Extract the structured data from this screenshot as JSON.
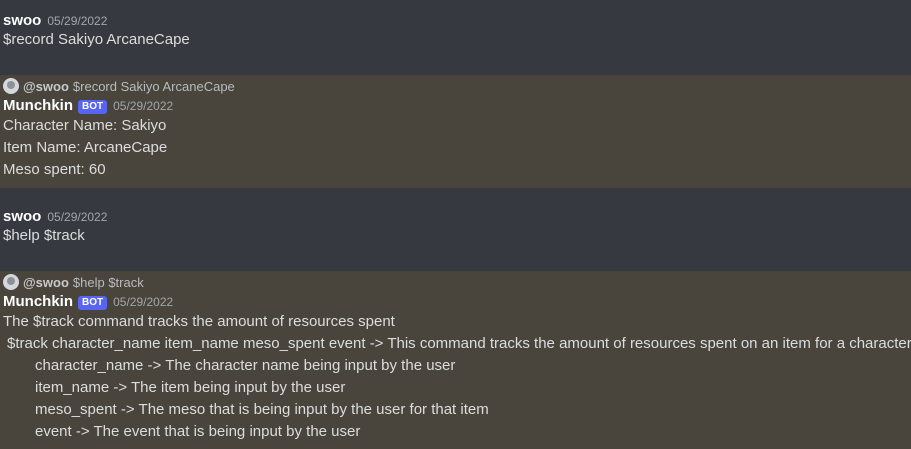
{
  "messages": [
    {
      "author": "swoo",
      "timestamp": "05/29/2022",
      "lines": [
        "$record Sakiyo ArcaneCape"
      ]
    },
    {
      "reply": {
        "user": "@swoo",
        "text": "$record Sakiyo ArcaneCape",
        "avatar_icon": "user-avatar-icon"
      },
      "author": "Munchkin",
      "bot_tag": "BOT",
      "timestamp": "05/29/2022",
      "lines": [
        "Character Name: Sakiyo",
        "Item Name: ArcaneCape",
        "Meso spent: 60"
      ]
    },
    {
      "author": "swoo",
      "timestamp": "05/29/2022",
      "lines": [
        "$help $track"
      ]
    },
    {
      "reply": {
        "user": "@swoo",
        "text": "$help $track",
        "avatar_icon": "user-avatar-icon"
      },
      "author": "Munchkin",
      "bot_tag": "BOT",
      "timestamp": "05/29/2022",
      "lines": [
        "The $track command tracks the amount of resources spent",
        "$track character_name item_name meso_spent event -> This command tracks the amount of resources spent on an item for a character",
        "character_name -> The character name being input by the user",
        "item_name -> The item being input by the user",
        "meso_spent -> The meso that is being input by the user for that item",
        "event -> The event that is being input by the user"
      ]
    }
  ],
  "colors": {
    "background": "#36393f",
    "mention_highlight": "#49443c",
    "bot_tag": "#5865f2"
  }
}
